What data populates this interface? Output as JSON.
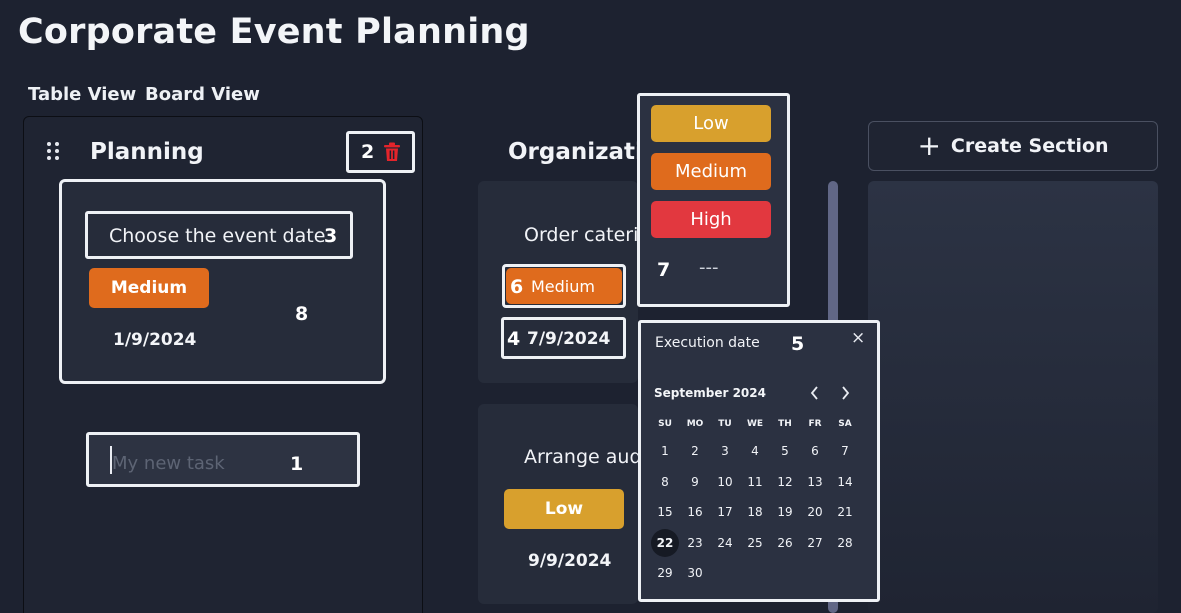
{
  "page_title": "Corporate Event Planning",
  "view_tabs": [
    "Table View",
    "Board View"
  ],
  "planning": {
    "title": "Planning",
    "count": "2",
    "task": {
      "title": "Choose the event date",
      "priority": "Medium",
      "date": "1/9/2024"
    },
    "new_task_placeholder": "My new task"
  },
  "organization": {
    "title": "Organizatio",
    "tasks": [
      {
        "title": "Order caterin",
        "priority": "Medium",
        "date": "7/9/2024"
      },
      {
        "title": "Arrange audi",
        "priority": "Low",
        "date": "9/9/2024"
      }
    ]
  },
  "create_section_label": "Create Section",
  "priority_menu": {
    "options": [
      "Low",
      "Medium",
      "High"
    ],
    "none_label": "---"
  },
  "date_picker": {
    "title": "Execution date",
    "close": "×",
    "month": "September 2024",
    "weekdays": [
      "SU",
      "MO",
      "TU",
      "WE",
      "TH",
      "FR",
      "SA"
    ],
    "days": [
      "1",
      "2",
      "3",
      "4",
      "5",
      "6",
      "7",
      "8",
      "9",
      "10",
      "11",
      "12",
      "13",
      "14",
      "15",
      "16",
      "17",
      "18",
      "19",
      "20",
      "21",
      "22",
      "23",
      "24",
      "25",
      "26",
      "27",
      "28",
      "29",
      "30"
    ],
    "selected_day": "22"
  },
  "annotation_numbers": [
    "1",
    "2",
    "3",
    "4",
    "5",
    "6",
    "7",
    "8"
  ],
  "colors": {
    "medium": "#df6b1d",
    "low": "#d8a02d",
    "high": "#e2383f",
    "background": "#1d2230"
  }
}
